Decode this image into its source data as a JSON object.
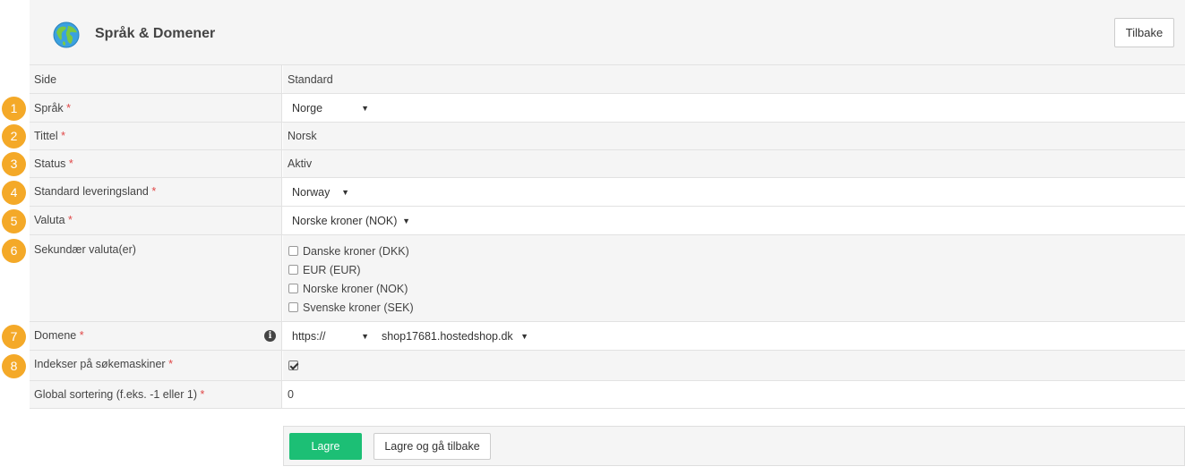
{
  "header": {
    "title": "Språk & Domener",
    "back_label": "Tilbake",
    "icon": "globe-icon"
  },
  "required_mark": "*",
  "columns": {
    "side": "Side",
    "standard": "Standard"
  },
  "fields": {
    "language": {
      "badge": "1",
      "label": "Språk",
      "value": "Norge"
    },
    "title": {
      "badge": "2",
      "label": "Tittel",
      "value": "Norsk"
    },
    "status": {
      "badge": "3",
      "label": "Status",
      "value": "Aktiv"
    },
    "delivery_country": {
      "badge": "4",
      "label": "Standard leveringsland",
      "value": "Norway"
    },
    "currency": {
      "badge": "5",
      "label": "Valuta",
      "value": "Norske kroner (NOK)"
    },
    "secondary_currencies": {
      "badge": "6",
      "label": "Sekundær valuta(er)",
      "options": [
        {
          "label": "Danske kroner (DKK)",
          "checked": false
        },
        {
          "label": "EUR (EUR)",
          "checked": false
        },
        {
          "label": "Norske kroner (NOK)",
          "checked": false
        },
        {
          "label": "Svenske kroner (SEK)",
          "checked": false
        }
      ]
    },
    "domain": {
      "badge": "7",
      "label": "Domene",
      "protocol": "https://",
      "host": "shop17681.hostedshop.dk",
      "info_icon": "i"
    },
    "indexing": {
      "badge": "8",
      "label": "Indekser på søkemaskiner",
      "checked": true
    },
    "global_sort": {
      "label": "Global sortering (f.eks. -1 eller 1)",
      "value": "0"
    }
  },
  "footer": {
    "save_label": "Lagre",
    "save_back_label": "Lagre og gå tilbake"
  },
  "colors": {
    "badge": "#f4a928",
    "save": "#1cbf75",
    "required": "#e04848"
  }
}
